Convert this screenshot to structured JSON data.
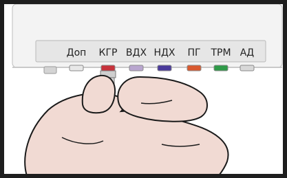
{
  "connector_panel": {
    "labels": [
      "Доп",
      "КГР",
      "ВДХ",
      "НДХ",
      "ПГ",
      "ТРМ",
      "АД"
    ],
    "socket_colors": [
      "#e8e8e8",
      "#c7323b",
      "#b9a6cf",
      "#4a3a9b",
      "#d9592f",
      "#2e9a48",
      "#d8d8d8"
    ]
  },
  "colors": {
    "frame": "#1e1e1e",
    "device_body": "#f3f3f3",
    "panel_strip": "#e6e6e6",
    "hand_skin": "#f1dad3",
    "hand_outline": "#1a1a1a",
    "plug_metal": "#c9c9c9",
    "plug_sleeve": "#a8302e",
    "cable": "#111111"
  }
}
